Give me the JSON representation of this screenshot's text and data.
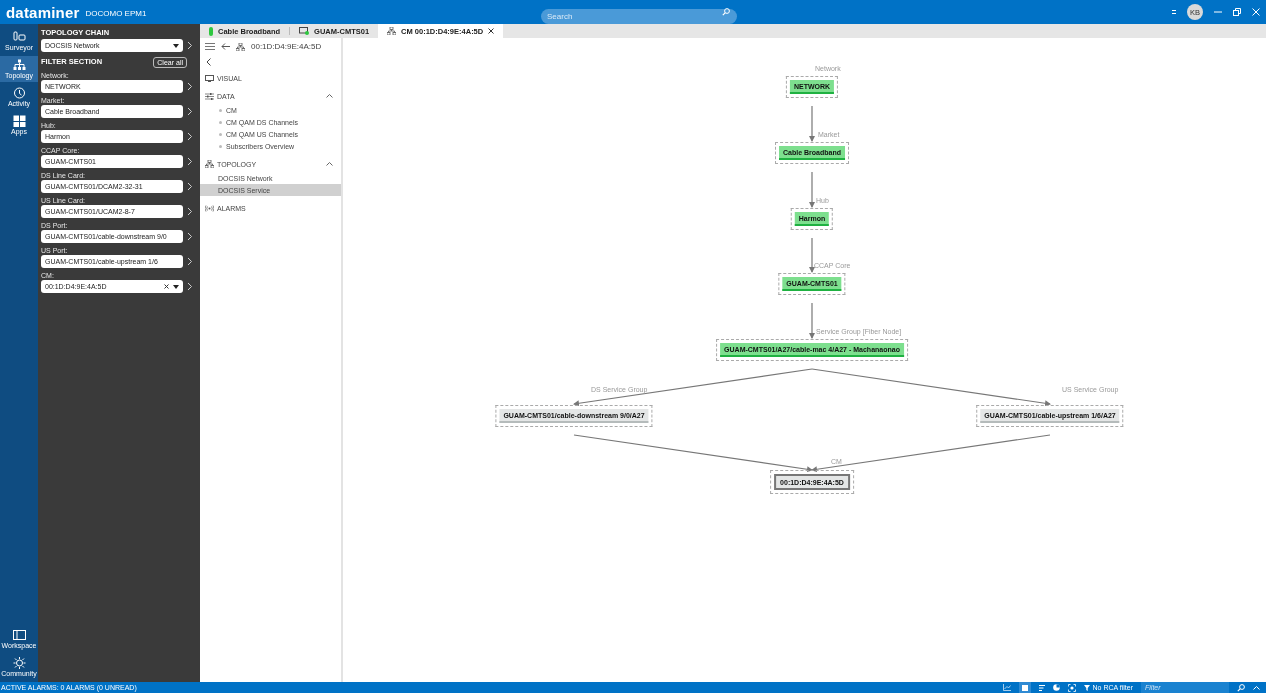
{
  "app": {
    "logo": "dataminer",
    "system": "DOCOMO EPM1",
    "search": {
      "placeholder": "Search"
    },
    "user_initials": "KB"
  },
  "rail": {
    "items": [
      {
        "label": "Surveyor",
        "kind": "surveyor",
        "selected": false
      },
      {
        "label": "Topology",
        "kind": "topology",
        "selected": true
      },
      {
        "label": "Activity",
        "kind": "activity",
        "selected": false
      },
      {
        "label": "Apps",
        "kind": "apps",
        "selected": false
      }
    ],
    "bottom_items": [
      {
        "label": "Workspace",
        "kind": "workspace"
      },
      {
        "label": "Community",
        "kind": "community"
      }
    ]
  },
  "filter_panel": {
    "chain_heading": "TOPOLOGY CHAIN",
    "chain": {
      "value": "DOCSIS Network"
    },
    "section_heading": "FILTER SECTION",
    "clear_button": "Clear all",
    "filters": [
      {
        "label": "Network:",
        "value": "NETWORK",
        "clearable": false
      },
      {
        "label": "Market:",
        "value": "Cable Broadband",
        "clearable": false
      },
      {
        "label": "Hub:",
        "value": "Harmon",
        "clearable": false
      },
      {
        "label": "CCAP Core:",
        "value": "GUAM-CMTS01",
        "clearable": false
      },
      {
        "label": "DS Line Card:",
        "value": "GUAM-CMTS01/DCAM2-32-31",
        "clearable": false
      },
      {
        "label": "US Line Card:",
        "value": "GUAM-CMTS01/UCAM2-8-7",
        "clearable": false
      },
      {
        "label": "DS Port:",
        "value": "GUAM-CMTS01/cable-downstream 9/0",
        "clearable": false
      },
      {
        "label": "US Port:",
        "value": "GUAM-CMTS01/cable-upstream 1/6",
        "clearable": false
      },
      {
        "label": "CM:",
        "value": "00:1D:D4:9E:4A:5D",
        "clearable": true
      }
    ]
  },
  "tabs": [
    {
      "label": "Cable Broadband",
      "kind": "service",
      "selected": false
    },
    {
      "label": "GUAM-CMTS01",
      "kind": "element",
      "selected": false
    },
    {
      "label": "CM 00:1D:D4:9E:4A:5D",
      "kind": "topology",
      "selected": true
    }
  ],
  "toolbar": {
    "title": "00:1D:D4:9E:4A:5D"
  },
  "side_nav": {
    "sections": [
      {
        "label": "VISUAL",
        "kind": "visual",
        "expanded": false
      },
      {
        "label": "DATA",
        "kind": "data",
        "expanded": true,
        "children": [
          {
            "label": "CM",
            "selected": false
          },
          {
            "label": "CM QAM DS Channels",
            "selected": false
          },
          {
            "label": "CM QAM US Channels",
            "selected": false
          },
          {
            "label": "Subscribers Overview",
            "selected": false
          }
        ]
      },
      {
        "label": "TOPOLOGY",
        "kind": "topology",
        "expanded": true,
        "children": [
          {
            "label": "DOCSIS Network",
            "selected": false
          },
          {
            "label": "DOCSIS Service",
            "selected": true
          }
        ]
      },
      {
        "label": "ALARMS",
        "kind": "alarms",
        "expanded": false
      }
    ]
  },
  "diagram": {
    "nodes": [
      {
        "level": "Network",
        "name": "NETWORK",
        "kind": "ok"
      },
      {
        "level": "Market",
        "name": "Cable Broadband",
        "kind": "ok"
      },
      {
        "level": "Hub",
        "name": "Harmon",
        "kind": "ok"
      },
      {
        "level": "CCAP Core",
        "name": "GUAM-CMTS01",
        "kind": "ok"
      },
      {
        "level": "Service Group [Fiber Node]",
        "name": "GUAM-CMTS01/A27/cable-mac 4/A27 - Machanaonao",
        "kind": "ok"
      },
      {
        "level": "DS Service Group",
        "name": "GUAM-CMTS01/cable-downstream 9/0/A27",
        "kind": "neutral"
      },
      {
        "level": "US Service Group",
        "name": "GUAM-CMTS01/cable-upstream 1/6/A27",
        "kind": "neutral"
      },
      {
        "level": "CM",
        "name": "00:1D:D4:9E:4A:5D",
        "kind": "selected"
      }
    ]
  },
  "status_bar": {
    "alarms": "ACTIVE ALARMS: 0 ALARMS (0 UNREAD)",
    "rca_filter": "No RCA filter",
    "filter": {
      "placeholder": "Filter"
    }
  }
}
